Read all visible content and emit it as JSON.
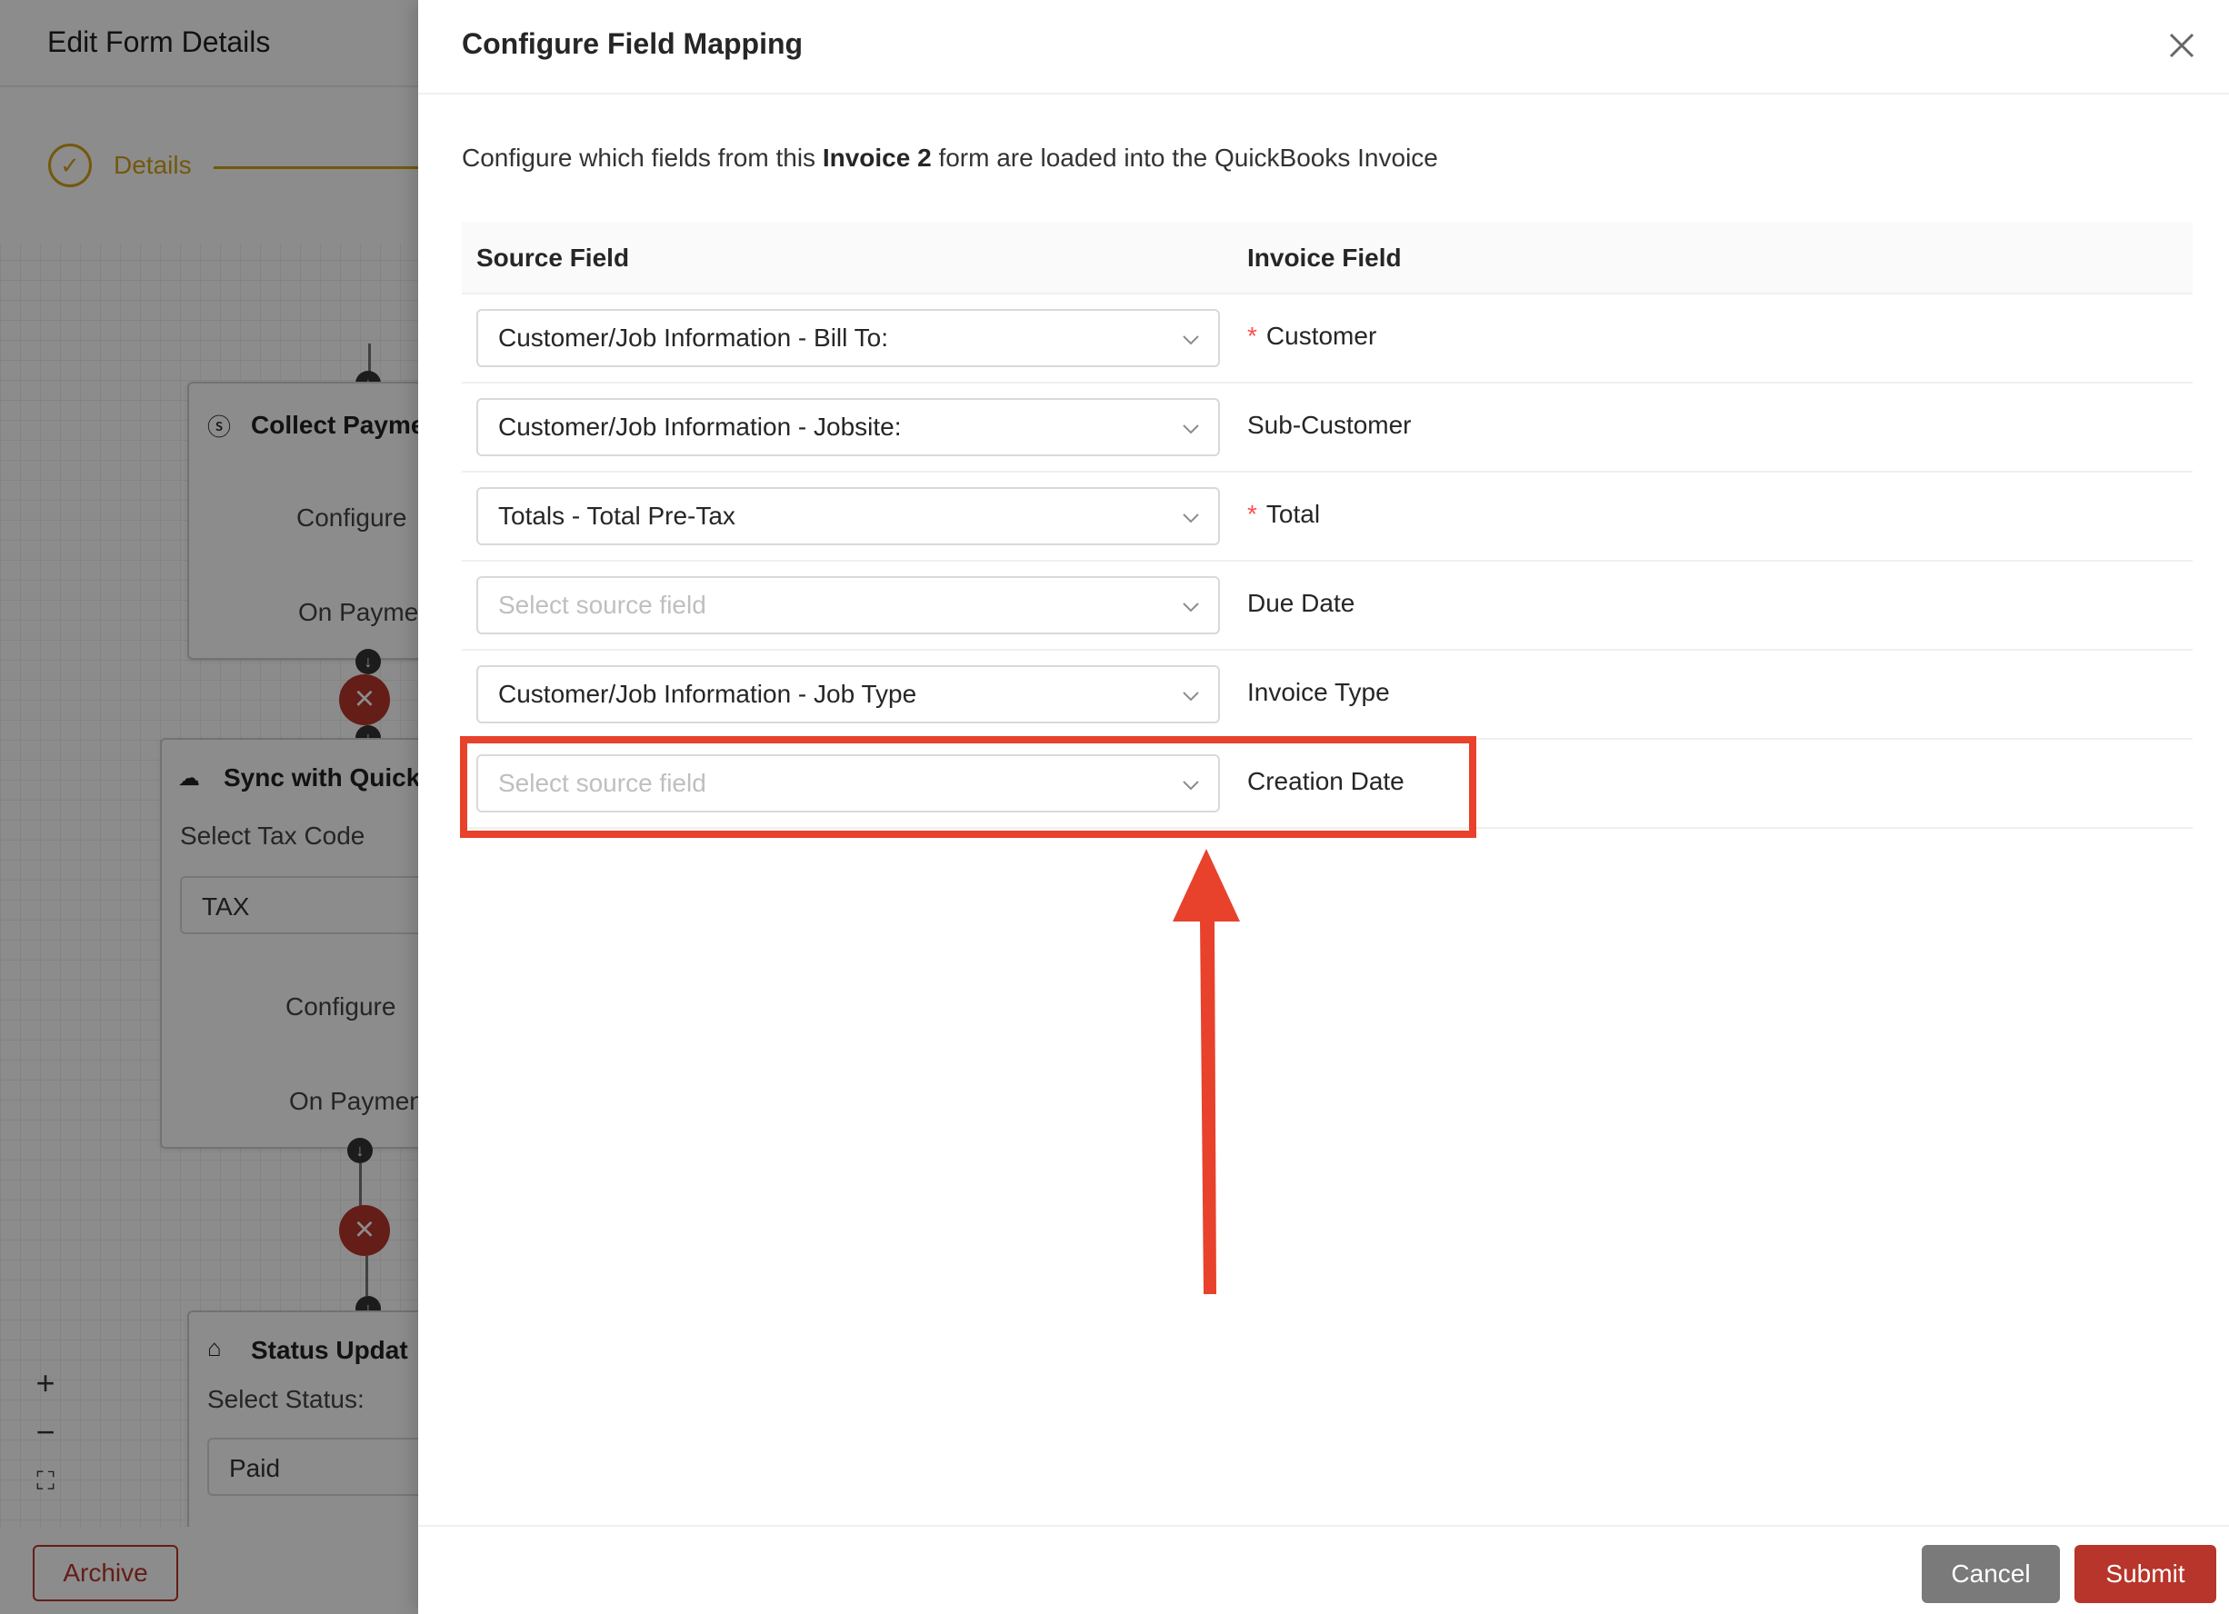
{
  "background": {
    "page_title": "Edit Form Details",
    "step": {
      "label": "Details",
      "icon": "check-circle-icon"
    },
    "nodes": {
      "collect_payment": {
        "title": "Collect Payme",
        "configure": "Configure",
        "on_payment": "On Payme"
      },
      "sync_quickbooks": {
        "title": "Sync with Quick",
        "tax_label": "Select Tax Code",
        "tax_value": "TAX",
        "configure": "Configure",
        "on_payment": "On Paymen"
      },
      "status_update": {
        "title": "Status Updat",
        "status_label": "Select Status:",
        "status_value": "Paid"
      }
    },
    "zoom": {
      "in": "+",
      "out": "−",
      "fit": "⛶"
    },
    "archive_label": "Archive"
  },
  "drawer": {
    "title": "Configure Field Mapping",
    "intro": {
      "prefix": "Configure which fields from this ",
      "form_name": "Invoice 2",
      "suffix": " form are loaded into the QuickBooks Invoice"
    },
    "columns": {
      "source": "Source Field",
      "invoice": "Invoice Field"
    },
    "rows": [
      {
        "source": "Customer/Job Information - Bill To:",
        "placeholder": false,
        "invoice": "Customer",
        "required": true
      },
      {
        "source": "Customer/Job Information - Jobsite:",
        "placeholder": false,
        "invoice": "Sub-Customer",
        "required": false
      },
      {
        "source": "Totals - Total Pre-Tax",
        "placeholder": false,
        "invoice": "Total",
        "required": true
      },
      {
        "source": "Select source field",
        "placeholder": true,
        "invoice": "Due Date",
        "required": false
      },
      {
        "source": "Customer/Job Information - Job Type",
        "placeholder": false,
        "invoice": "Invoice Type",
        "required": false
      },
      {
        "source": "Select source field",
        "placeholder": true,
        "invoice": "Creation Date",
        "required": false
      }
    ],
    "required_mark": "*",
    "buttons": {
      "cancel": "Cancel",
      "submit": "Submit"
    }
  },
  "colors": {
    "accent": "#b7352a",
    "gold": "#d4a017",
    "annotation_red": "#e8412c",
    "cancel_gray": "#7a7a7a"
  }
}
